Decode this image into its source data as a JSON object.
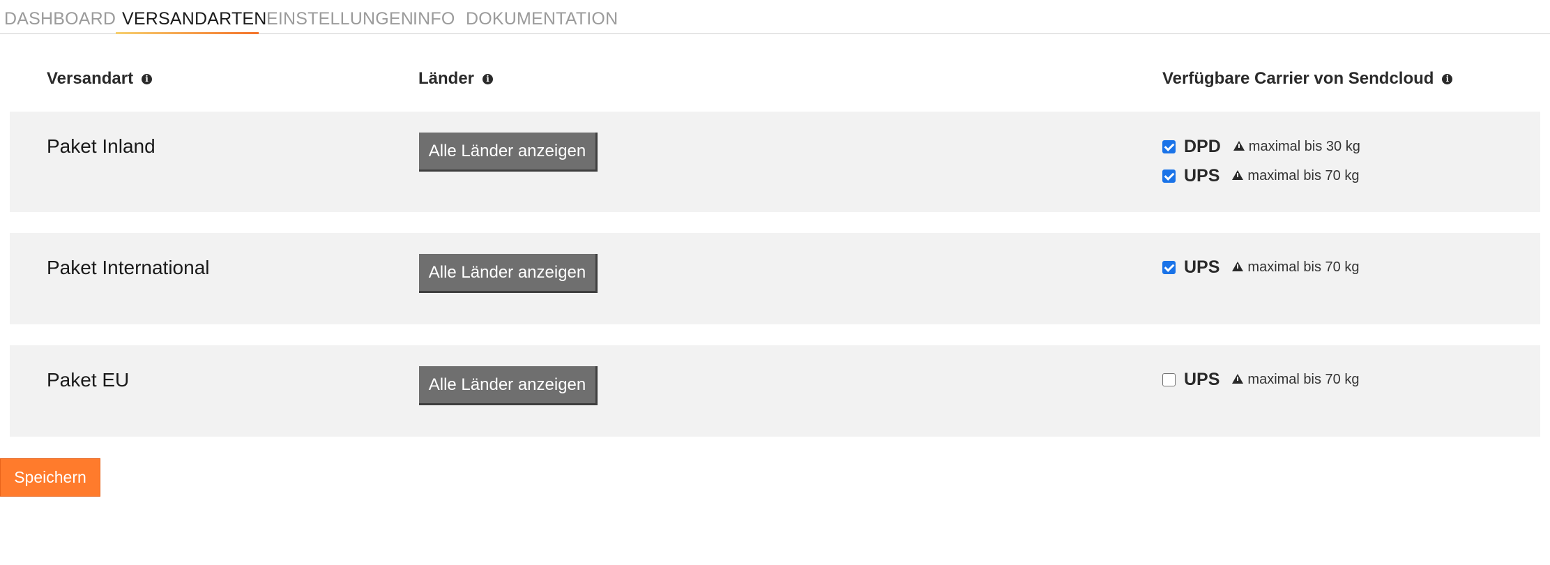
{
  "tabs": [
    {
      "label": "DASHBOARD",
      "active": false
    },
    {
      "label": "VERSANDARTEN",
      "active": true
    },
    {
      "label": "EINSTELLUNGEN",
      "active": false
    },
    {
      "label": "INFO",
      "active": false
    },
    {
      "label": "DOKUMENTATION",
      "active": false
    }
  ],
  "table": {
    "headers": {
      "shipping_method": "Versandart",
      "countries": "Länder",
      "carriers": "Verfügbare Carrier von Sendcloud"
    },
    "rows": [
      {
        "name": "Paket Inland",
        "countries_button": "Alle Länder anzeigen",
        "carriers": [
          {
            "name": "DPD",
            "checked": true,
            "note": "maximal bis 30 kg"
          },
          {
            "name": "UPS",
            "checked": true,
            "note": "maximal bis 70 kg"
          }
        ]
      },
      {
        "name": "Paket International",
        "countries_button": "Alle Länder anzeigen",
        "carriers": [
          {
            "name": "UPS",
            "checked": true,
            "note": "maximal bis 70 kg"
          }
        ]
      },
      {
        "name": "Paket EU",
        "countries_button": "Alle Länder anzeigen",
        "carriers": [
          {
            "name": "UPS",
            "checked": false,
            "note": "maximal bis 70 kg"
          }
        ]
      }
    ]
  },
  "save_label": "Speichern",
  "colors": {
    "accent": "#ff7b2c",
    "checkbox": "#1a73e8",
    "button_gray": "#6f6f6f",
    "row_background": "#f2f2f2"
  },
  "icons": {
    "header_info": "info-circle-icon",
    "carrier_note": "warning-triangle-icon"
  }
}
